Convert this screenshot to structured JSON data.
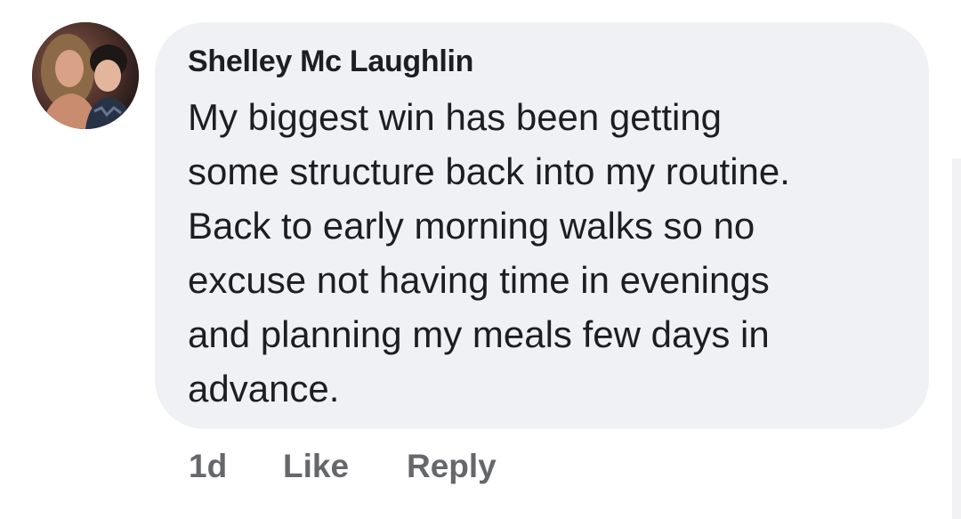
{
  "comment": {
    "author": "Shelley Mc Laughlin",
    "text_lines": [
      "My biggest win has been getting",
      "some structure back into my routine.",
      "Back to early morning walks so no",
      "excuse not having time in evenings",
      "and planning my meals few days in",
      "advance."
    ],
    "timestamp": "1d",
    "like_label": "Like",
    "reply_label": "Reply"
  },
  "colors": {
    "bubble_background": "#f0f1f4",
    "text_primary": "#1c1e21",
    "text_secondary": "#65676b"
  },
  "icons": {
    "avatar": "profile-photo"
  }
}
